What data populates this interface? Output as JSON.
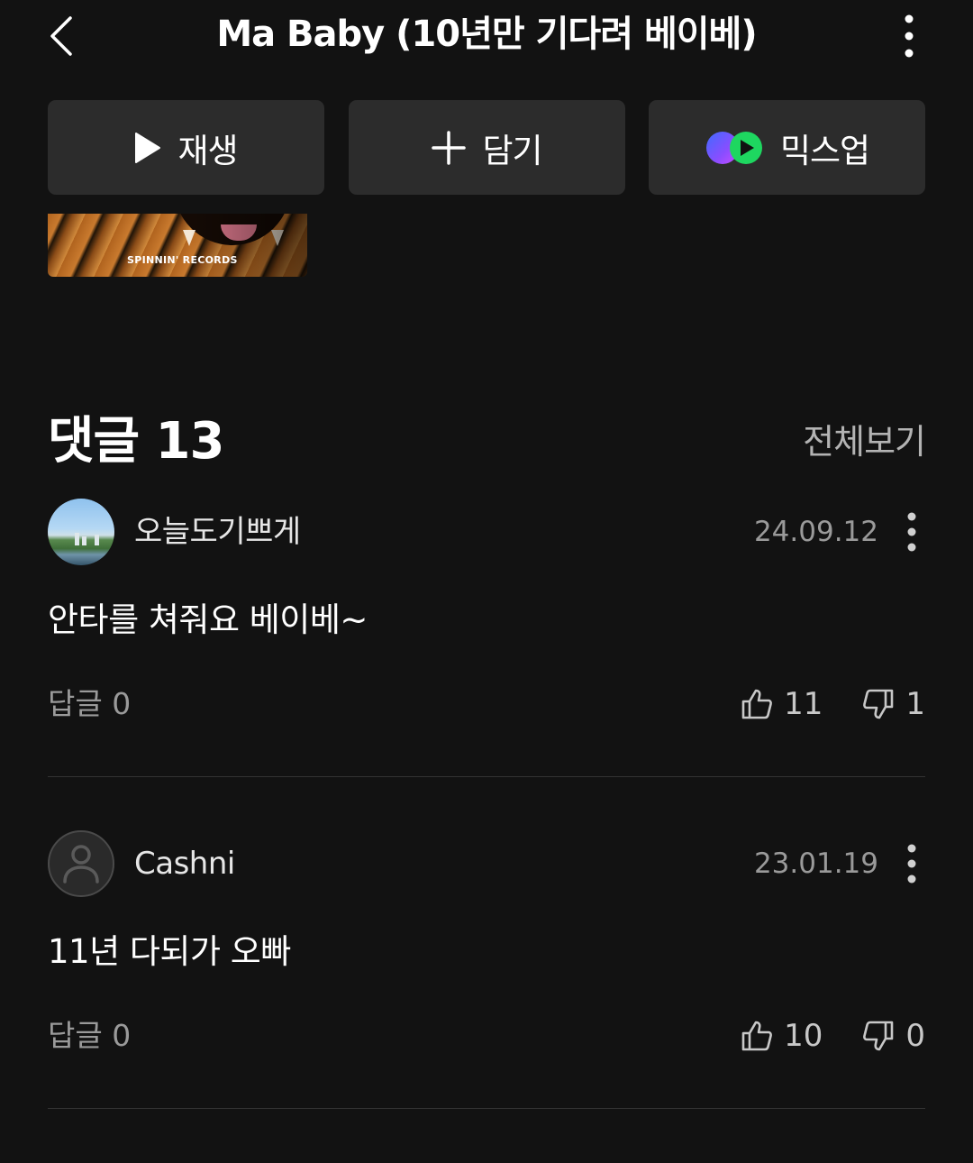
{
  "header": {
    "title": "Ma Baby (10년만 기다려 베이베)"
  },
  "actions": {
    "play_label": "재생",
    "add_label": "담기",
    "mixup_label": "믹스업"
  },
  "cover": {
    "label": "SPINNIN' RECORDS"
  },
  "comments": {
    "title": "댓글 13",
    "view_all": "전체보기",
    "items": [
      {
        "username": "오늘도기쁘게",
        "date": "24.09.12",
        "text": "안타를 쳐줘요 베이베~",
        "replies": "답글 0",
        "likes": "11",
        "dislikes": "1"
      },
      {
        "username": "Cashni",
        "date": "23.01.19",
        "text": "11년 다되가 오빠",
        "replies": "답글 0",
        "likes": "10",
        "dislikes": "0"
      }
    ]
  },
  "colors": {
    "background": "#121212",
    "button_bg": "#2c2c2c",
    "secondary_text": "#9a9a9a",
    "mixup_purple": "#7b4dff",
    "mixup_green": "#1ed760"
  },
  "icons": {
    "back": "chevron-left-icon",
    "more": "vertical-ellipsis-icon",
    "play": "play-icon",
    "add": "plus-icon",
    "mixup": "mixup-logo-icon",
    "like": "thumbs-up-icon",
    "dislike": "thumbs-down-icon",
    "default_avatar": "person-icon"
  }
}
